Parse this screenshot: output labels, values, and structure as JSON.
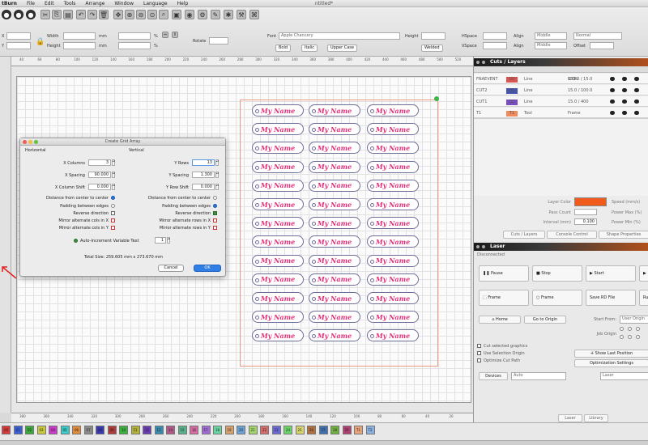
{
  "menubar": {
    "app": "tBurn",
    "items": [
      "File",
      "Edit",
      "Tools",
      "Arrange",
      "Window",
      "Language",
      "Help"
    ],
    "window_title": "ntitled*"
  },
  "toolbar": {
    "width_label": "Width",
    "height_label": "Height",
    "rotate_label": "Rotate",
    "font_label": "Font",
    "font_value": "Apple Chancery",
    "font_height_label": "Height",
    "hspace_label": "HSpace",
    "vspace_label": "VSpace",
    "align_label": "Align",
    "align_h_value": "Middle",
    "align_v_value": "Middle",
    "offset_label": "Offset",
    "normal_value": "Normal",
    "bold": "Bold",
    "italic": "Italic",
    "upper_case": "Upper Case",
    "welded": "Welded",
    "percent_symbol": "%",
    "units": "mm"
  },
  "ruler_top": [
    "40",
    "60",
    "80",
    "100",
    "120",
    "140",
    "160",
    "180",
    "200",
    "220",
    "240",
    "260",
    "280",
    "300",
    "320",
    "340",
    "360",
    "380",
    "400",
    "420",
    "440",
    "460",
    "480",
    "500",
    "520"
  ],
  "ruler_bottom": [
    "380",
    "360",
    "340",
    "320",
    "300",
    "280",
    "260",
    "240",
    "220",
    "200",
    "180",
    "160",
    "140",
    "120",
    "100",
    "80",
    "60",
    "40",
    "20"
  ],
  "tag_text": "My Name",
  "grid": {
    "columns": 3,
    "rows": 13
  },
  "dialog": {
    "title": "Create Grid Array",
    "horizontal": "Horizontal",
    "vertical": "Vertical",
    "x_columns_label": "X Columns",
    "x_columns_value": "3",
    "y_rows_label": "Y Rows",
    "y_rows_value": "13",
    "x_spacing_label": "X Spacing",
    "x_spacing_value": "90.000",
    "y_spacing_label": "Y Spacing",
    "y_spacing_value": "1.300",
    "x_col_shift_label": "X Column Shift",
    "x_col_shift_value": "0.000",
    "y_row_shift_label": "Y Row Shift",
    "y_row_shift_value": "0.000",
    "distance_label": "Distance from center to center",
    "padding_label": "Padding between edges",
    "reverse_label": "Reverse direction",
    "mirror_x_cols": "Mirror alternate cols in X",
    "mirror_y_cols": "Mirror alternate cols in Y",
    "mirror_x_rows": "Mirror alternate rows in X",
    "mirror_y_rows": "Mirror alternate rows in Y",
    "auto_increment": "Auto-Increment Variable Text",
    "auto_increment_value": "1",
    "total_size": "Total Size: 259.605 mm x 273.670 mm",
    "cancel": "Cancel",
    "ok": "OK"
  },
  "cuts_panel": {
    "title": "Cuts / Layers",
    "rows": [
      {
        "name": "FNAEVENT",
        "color": "#d9534f",
        "num": "00",
        "mode": "Line",
        "speed": "180.0 / 15.0",
        "out_name": "ICON"
      },
      {
        "name": "CUT2",
        "color": "#4455aa",
        "num": "01",
        "mode": "Line",
        "speed": "15.0 / 100.0"
      },
      {
        "name": "CUT1",
        "color": "#7a4dbf",
        "num": "02",
        "mode": "Line",
        "speed": "15.0 / 400"
      },
      {
        "name": "T1",
        "color": "#f0895c",
        "num": "T1",
        "mode": "Tool",
        "speed": "",
        "out_name": "Frame"
      }
    ],
    "layer_color_label": "Layer Color",
    "layer_color_value": "#f05a1a",
    "speed_label": "Speed (mm/s)",
    "pass_count_label": "Pass Count",
    "interval_label": "Interval (mm)",
    "interval_value": "0.100",
    "power_max_label": "Power Max (%)",
    "power_min_label": "Power Min (%)",
    "tab_cuts": "Cuts / Layers",
    "tab_console": "Console Control",
    "tab_shape": "Shape Properties"
  },
  "laser_panel": {
    "title": "Laser",
    "status": "Disconnected",
    "pause": "Pause",
    "stop": "Stop",
    "start": "Start",
    "frame1": "Frame",
    "frame2": "Frame",
    "save_rd": "Save RD File",
    "run": "Run",
    "home": "Home",
    "go_origin": "Go to Origin",
    "start_from_label": "Start From:",
    "start_from_value": "User Origin",
    "job_origin_label": "Job Origin",
    "cut_selected": "Cut selected graphics",
    "use_selection_origin": "Use Selection Origin",
    "optimize_cut_path": "Optimize Cut Path",
    "show_last_position": "Show Last Position",
    "optimization_settings": "Optimization Settings",
    "devices_label": "Devices",
    "device_value": "Auto",
    "laser_value": "Laser",
    "tab_laser": "Laser",
    "tab_library": "Library"
  },
  "palette": [
    "00",
    "01",
    "02",
    "03",
    "04",
    "05",
    "06",
    "07",
    "08",
    "09",
    "10",
    "11",
    "12",
    "13",
    "14",
    "15",
    "16",
    "17",
    "18",
    "19",
    "20",
    "21",
    "22",
    "23",
    "24",
    "25",
    "26",
    "27",
    "28",
    "29",
    "T1",
    "T2"
  ],
  "palette_colors": [
    "#d43a3a",
    "#3a5fd4",
    "#3aa83a",
    "#c8c83a",
    "#c83ac8",
    "#3ac8c8",
    "#e08a3a",
    "#8a8a8a",
    "#3a3ab0",
    "#b03a3a",
    "#3ab03a",
    "#b0b03a",
    "#6a3ab0",
    "#3a8ab0",
    "#b05a8a",
    "#5ab08a",
    "#d46aa0",
    "#a06ad4",
    "#6ad4a0",
    "#d4a06a",
    "#6aa0d4",
    "#a0d46a",
    "#d46a6a",
    "#6a6ad4",
    "#6ad46a",
    "#d4d46a",
    "#b07040",
    "#4070b0",
    "#70b040",
    "#b04070",
    "#e7a27a",
    "#8ab0e0"
  ]
}
